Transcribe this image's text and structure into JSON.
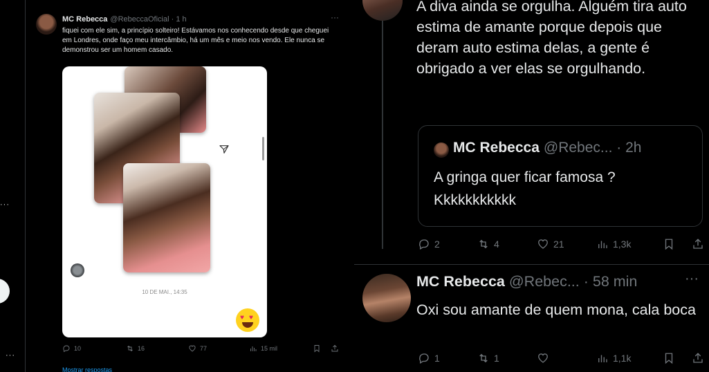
{
  "left_tweet": {
    "author_name": "MC Rebecca",
    "author_handle": "@RebeccaOficial · 1 h",
    "text": "fiquei com ele sim, a princípio solteiro! Estávamos nos conhecendo desde que cheguei em Londres, onde faço meu intercâmbio, há um mês e meio nos vendo. Ele nunca se demonstrou ser um homem casado.",
    "more": "···",
    "image": {
      "timestamp": "10 DE MAI., 14:35",
      "icons": [
        "send-icon",
        "heart-eyes-emoji"
      ]
    },
    "actions": {
      "replies": "10",
      "reposts": "16",
      "likes": "77",
      "views": "15 mil"
    },
    "show_replies": "Mostrar respostas"
  },
  "right_thread": {
    "reply_text": "A diva ainda se orgulha. Alguém tira auto estima de amante porque depois que deram auto estima delas, a gente é obrigado a ver elas se orgulhando.",
    "quote": {
      "author_name": "MC Rebecca",
      "author_handle": "@Rebec... · 2h",
      "text_line1": "A gringa quer ficar famosa ?",
      "text_line2": "Kkkkkkkkkkk"
    },
    "actions_1": {
      "replies": "2",
      "reposts": "4",
      "likes": "21",
      "views": "1,3k"
    },
    "tweet_2": {
      "author_name": "MC Rebecca",
      "author_handle": "@Rebec... · 58 min",
      "more": "···",
      "text": "Oxi sou amante de quem mona, cala boca"
    },
    "actions_2": {
      "replies": "1",
      "reposts": "1",
      "likes": "",
      "views": "1,1k"
    }
  },
  "colors": {
    "background": "#000000",
    "text_primary": "#e7e9ea",
    "text_secondary": "#71767b",
    "border": "#2f3336",
    "link": "#1d9bf0"
  }
}
